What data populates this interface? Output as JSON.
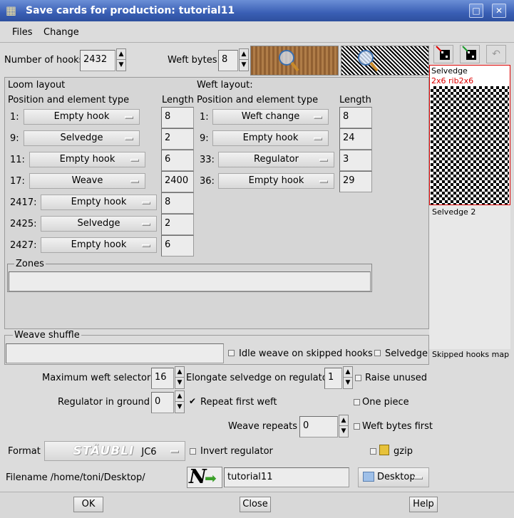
{
  "window": {
    "title": "Save cards for production: tutorial11"
  },
  "menu": [
    "Files",
    "Change"
  ],
  "top": {
    "hooks_label": "Number of hooks",
    "hooks_value": "2432",
    "weft_bytes_label": "Weft bytes",
    "weft_bytes_value": "8"
  },
  "loom": {
    "title": "Loom layout",
    "col1": "Position and element type",
    "col2": "Length",
    "rows": [
      {
        "pos": "1:",
        "type": "Empty hook",
        "len": "8"
      },
      {
        "pos": "9:",
        "type": "Selvedge",
        "len": "2"
      },
      {
        "pos": "11:",
        "type": "Empty hook",
        "len": "6"
      },
      {
        "pos": "17:",
        "type": "Weave",
        "len": "2400"
      },
      {
        "pos": "2417:",
        "type": "Empty hook",
        "len": "8"
      },
      {
        "pos": "2425:",
        "type": "Selvedge",
        "len": "2"
      },
      {
        "pos": "2427:",
        "type": "Empty hook",
        "len": "6"
      }
    ]
  },
  "weft": {
    "title": "Weft layout:",
    "col1": "Position and element type",
    "col2": "Length",
    "rows": [
      {
        "pos": "1:",
        "type": "Weft change",
        "len": "8"
      },
      {
        "pos": "9:",
        "type": "Empty hook",
        "len": "24"
      },
      {
        "pos": "33:",
        "type": "Regulator",
        "len": "3"
      },
      {
        "pos": "36:",
        "type": "Empty hook",
        "len": "29"
      }
    ]
  },
  "zones": {
    "label": "Zones",
    "value": ""
  },
  "shuffle": {
    "label": "Weave shuffle",
    "value": "",
    "idle": "Idle weave on skipped hooks",
    "selvedge": "Selvedge"
  },
  "side": {
    "title": "Selvedge",
    "subtitle": "2x6 rib2x6",
    "second": "Selvedge 2",
    "skipped": "Skipped hooks map"
  },
  "opts": {
    "max_weft_label": "Maximum weft selectors",
    "max_weft_value": "16",
    "elongate_label": "Elongate selvedge on regulator",
    "elongate_value": "1",
    "raise_unused": "Raise unused",
    "reg_ground_label": "Regulator in ground",
    "reg_ground_value": "0",
    "repeat_first": "Repeat first weft",
    "one_piece": "One piece",
    "weave_repeats_label": "Weave repeats",
    "weave_repeats_value": "0",
    "weft_bytes_first": "Weft bytes first",
    "format_label": "Format",
    "format_brand": "STÄUBLI",
    "format_model": "JC6",
    "invert_reg": "Invert regulator",
    "gzip": "gzip"
  },
  "file": {
    "label": "Filename /home/toni/Desktop/",
    "value": "tutorial11",
    "location": "Desktop"
  },
  "buttons": {
    "ok": "OK",
    "close": "Close",
    "help": "Help"
  }
}
